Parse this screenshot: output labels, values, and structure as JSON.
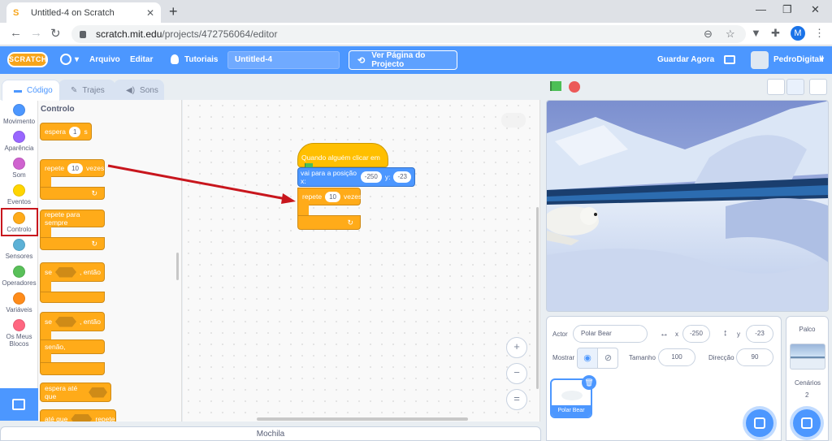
{
  "browser": {
    "tab_title": "Untitled-4 on Scratch",
    "url_domain": "scratch.mit.edu",
    "url_path": "/projects/472756064/editor",
    "profile_initial": "M"
  },
  "menubar": {
    "logo": "SCRATCH",
    "file": "Arquivo",
    "edit": "Editar",
    "tutorials": "Tutoriais",
    "project_title": "Untitled-4",
    "see_project_page": "Ver Página do Projecto",
    "save_now": "Guardar Agora",
    "username": "PedroDigitall"
  },
  "tabs": {
    "code": "Código",
    "costumes": "Trajes",
    "sounds": "Sons"
  },
  "categories": [
    {
      "label": "Movimento",
      "color": "#4c97ff"
    },
    {
      "label": "Aparência",
      "color": "#9966ff"
    },
    {
      "label": "Som",
      "color": "#cf63cf"
    },
    {
      "label": "Eventos",
      "color": "#ffd500"
    },
    {
      "label": "Controlo",
      "color": "#ffab19"
    },
    {
      "label": "Sensores",
      "color": "#5cb1d6"
    },
    {
      "label": "Operadores",
      "color": "#59c059"
    },
    {
      "label": "Variáveis",
      "color": "#ff8c1a"
    },
    {
      "label": "Os Meus Blocos",
      "color": "#ff6680"
    }
  ],
  "palette": {
    "heading": "Controlo",
    "wait": {
      "label": "espera",
      "value": "1",
      "unit": "s"
    },
    "repeat": {
      "label": "repete",
      "value": "10",
      "unit": "vezes"
    },
    "forever": {
      "label": "repete para sempre"
    },
    "if_then": {
      "label": "se",
      "then": ", então"
    },
    "if_else": {
      "label": "se",
      "then": ", então",
      "else": "senão,"
    },
    "wait_until": {
      "label": "espera até que"
    },
    "repeat_until": {
      "label": "até que",
      "suffix": "repete"
    },
    "loop_arrow": "↻"
  },
  "script": {
    "hat": "Quando alguém clicar em",
    "goto_label": "vai para a posição x:",
    "goto_x": "-250",
    "goto_y_label": "y:",
    "goto_y": "-23",
    "repeat_label": "repete",
    "repeat_value": "10",
    "repeat_unit": "vezes",
    "loop_arrow": "↻"
  },
  "zoom": {
    "in": "+",
    "out": "−",
    "reset": "="
  },
  "sprite": {
    "actor_label": "Actor",
    "name": "Polar Bear",
    "x_label": "x",
    "x": "-250",
    "y_label": "y",
    "y": "-23",
    "show_label": "Mostrar",
    "size_label": "Tamanho",
    "size": "100",
    "direction_label": "Direcção",
    "direction": "90",
    "thumb_name": "Polar Bear"
  },
  "stage_pane": {
    "heading": "Palco",
    "backdrops_label": "Cenários",
    "backdrops_count": "2"
  },
  "backpack": "Mochila",
  "colors": {
    "accent": "#4c97ff",
    "control": "#ffab19",
    "events": "#ffbf00",
    "highlight": "#c8161d"
  }
}
